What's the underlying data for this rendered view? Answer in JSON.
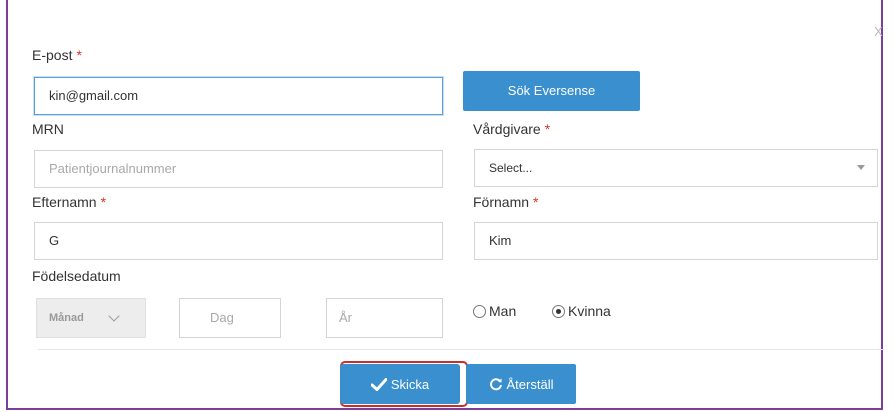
{
  "dialog": {
    "close_label": "X"
  },
  "form": {
    "email": {
      "label": "E-post",
      "required_mark": "*",
      "value": "kin@gmail.com"
    },
    "search_button": "Sök Eversense",
    "mrn": {
      "label": "MRN",
      "placeholder": "Patientjournalnummer"
    },
    "provider": {
      "label": "Vårdgivare",
      "required_mark": "*",
      "selected": "Select..."
    },
    "last_name": {
      "label": "Efternamn",
      "required_mark": "*",
      "value": "G"
    },
    "first_name": {
      "label": "Förnamn",
      "required_mark": "*",
      "value": "Kim"
    },
    "birthdate": {
      "label": "Födelsedatum",
      "month_placeholder": "Månad",
      "day_placeholder": "Dag",
      "year_placeholder": "År"
    },
    "gender": {
      "options": [
        {
          "label": "Man",
          "checked": false
        },
        {
          "label": "Kvinna",
          "checked": true
        }
      ]
    }
  },
  "actions": {
    "submit_label": "Skicka",
    "reset_label": "Återställ"
  },
  "colors": {
    "accent": "#3a8fcf",
    "required": "#d9342b",
    "frame": "#7b3f98",
    "highlight": "#c9302c"
  }
}
